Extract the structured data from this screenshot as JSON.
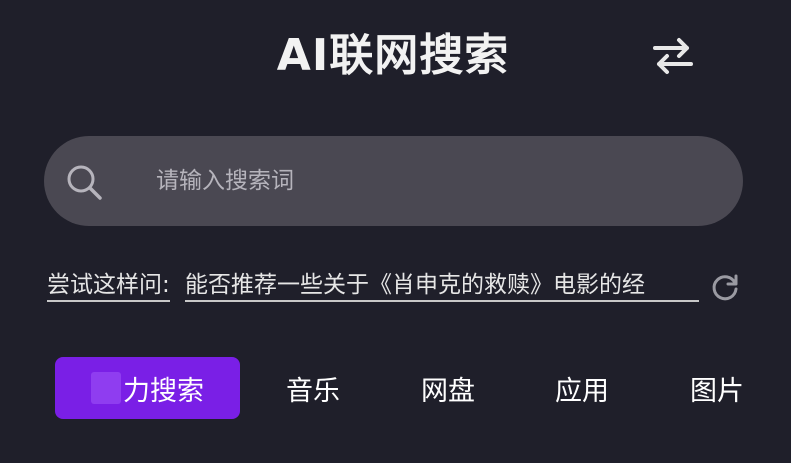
{
  "header": {
    "title": "AI联网搜索",
    "swap_icon": "swap-arrows-icon"
  },
  "search": {
    "placeholder": "请输入搜索词",
    "value": "",
    "icon": "search-icon"
  },
  "suggestion": {
    "prefix": "尝试这样问:",
    "text": "能否推荐一些关于《肖申克的救赎》电影的经",
    "refresh_icon": "refresh-icon"
  },
  "tabs": [
    {
      "label": "力搜索",
      "active": true
    },
    {
      "label": "音乐",
      "active": false
    },
    {
      "label": "网盘",
      "active": false
    },
    {
      "label": "应用",
      "active": false
    },
    {
      "label": "图片",
      "active": false
    }
  ],
  "colors": {
    "background": "#1f1f2a",
    "search_bg": "#4a4852",
    "accent": "#7a1fe6"
  }
}
